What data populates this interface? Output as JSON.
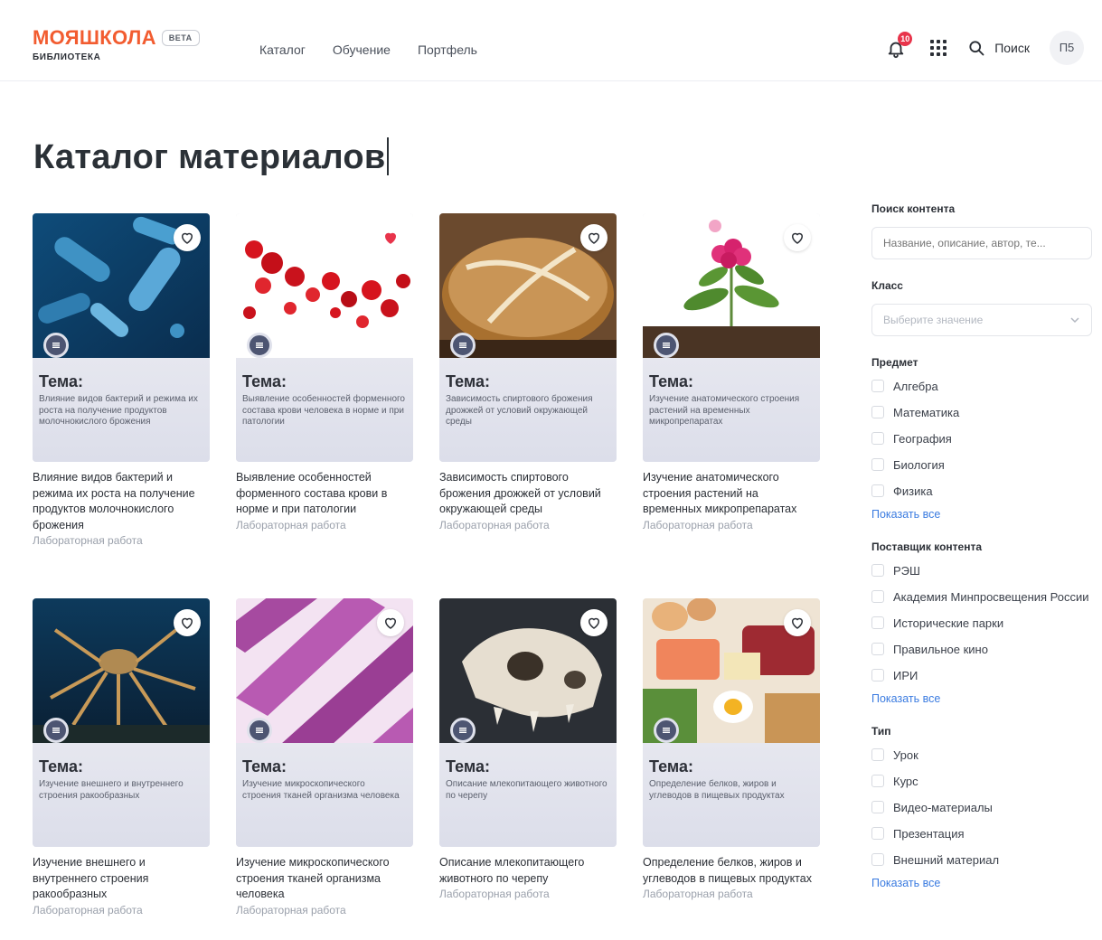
{
  "header": {
    "logo": "МОЯШКОЛА",
    "beta": "BETA",
    "logo_sub": "БИБЛИОТЕКА",
    "nav": [
      "Каталог",
      "Обучение",
      "Портфель"
    ],
    "notifications_count": "10",
    "search_label": "Поиск",
    "avatar_initials": "П5"
  },
  "page": {
    "title": "Каталог материалов"
  },
  "cards": [
    {
      "topic": "Тема:",
      "panel_text": "Влияние видов бактерий и режима их роста на получение продуктов молочнокислого брожения",
      "title": "Влияние видов бактерий и режима их роста на получение продуктов молочнокислого брожения",
      "type": "Лабораторная работа",
      "favorite": false
    },
    {
      "topic": "Тема:",
      "panel_text": "Выявление особенностей форменного состава крови человека в норме и при патологии",
      "title": "Выявление особенностей форменного состава крови в норме и при патологии",
      "type": "Лабораторная работа",
      "favorite": true
    },
    {
      "topic": "Тема:",
      "panel_text": "Зависимость спиртового брожения дрожжей от условий окружающей среды",
      "title": "Зависимость спиртового брожения дрожжей от условий окружающей среды",
      "type": "Лабораторная работа",
      "favorite": false
    },
    {
      "topic": "Тема:",
      "panel_text": "Изучение анатомического строения растений на временных микропрепаратах",
      "title": "Изучение анатомического строения растений на временных микропрепаратах",
      "type": "Лабораторная работа",
      "favorite": false
    },
    {
      "topic": "Тема:",
      "panel_text": "Изучение внешнего и внутреннего строения ракообразных",
      "title": "Изучение внешнего и внутреннего строения ракообразных",
      "type": "Лабораторная работа",
      "favorite": false
    },
    {
      "topic": "Тема:",
      "panel_text": "Изучение микроскопического строения тканей организма человека",
      "title": "Изучение микроскопического строения тканей организма человека",
      "type": "Лабораторная работа",
      "favorite": false
    },
    {
      "topic": "Тема:",
      "panel_text": "Описание млекопитающего животного по черепу",
      "title": "Описание млекопитающего животного по черепу",
      "type": "Лабораторная работа",
      "favorite": false
    },
    {
      "topic": "Тема:",
      "panel_text": "Определение белков, жиров и углеводов в пищевых продуктах",
      "title": "Определение белков, жиров и углеводов в пищевых продуктах",
      "type": "Лабораторная работа",
      "favorite": false
    }
  ],
  "sidebar": {
    "search": {
      "heading": "Поиск контента",
      "placeholder": "Название, описание, автор, те..."
    },
    "grade": {
      "heading": "Класс",
      "placeholder": "Выберите значение"
    },
    "subject": {
      "heading": "Предмет",
      "options": [
        "Алгебра",
        "Математика",
        "География",
        "Биология",
        "Физика"
      ],
      "show_all": "Показать все"
    },
    "provider": {
      "heading": "Поставщик контента",
      "options": [
        "РЭШ",
        "Академия Минпросвещения России",
        "Исторические парки",
        "Правильное кино",
        "ИРИ"
      ],
      "show_all": "Показать все"
    },
    "type": {
      "heading": "Тип",
      "options": [
        "Урок",
        "Курс",
        "Видео-материалы",
        "Презентация",
        "Внешний материал"
      ],
      "show_all": "Показать все"
    }
  },
  "colors": {
    "brand": "#f25c30",
    "link": "#3a7be0",
    "favorite": "#e8344b"
  },
  "icons": {
    "notifications": "bell-icon",
    "apps": "apps-grid-icon",
    "search": "search-icon",
    "favorite": "heart-icon",
    "material": "list-icon",
    "dropdown": "chevron-down-icon"
  }
}
